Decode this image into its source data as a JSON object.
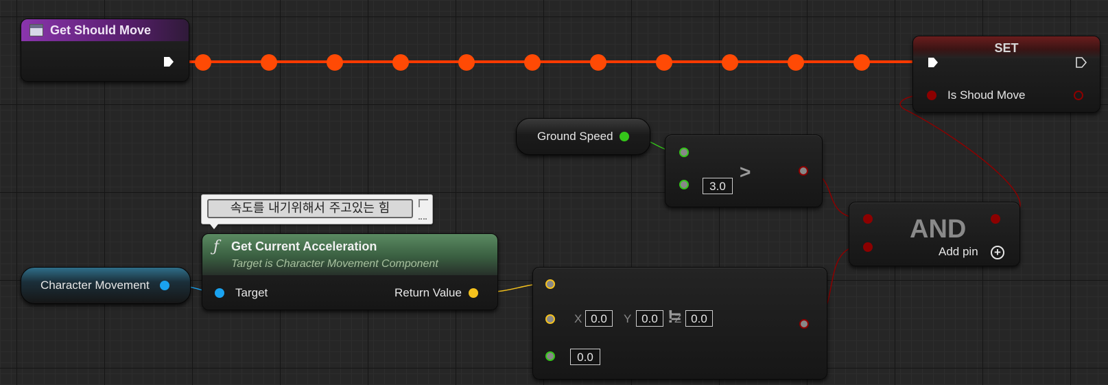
{
  "event_node": {
    "title": "Get Should Move",
    "header_color": "#6e2a8a"
  },
  "set_node": {
    "title": "SET",
    "pin_label": "Is Shoud Move",
    "header_color": "#5a1717"
  },
  "ground_speed_node": {
    "label": "Ground Speed",
    "pin_color": "#35c61a"
  },
  "greater_node": {
    "operator": ">",
    "b_value": "3.0"
  },
  "and_node": {
    "title": "AND",
    "add_pin_label": "Add pin"
  },
  "comment_bubble": {
    "text": "속도를 내기위해서 주고있는 힘"
  },
  "get_accel_node": {
    "title": "Get Current Acceleration",
    "subtitle": "Target is Character Movement Component",
    "target_label": "Target",
    "return_label": "Return Value",
    "header_color": "#3f6b45"
  },
  "char_movement_node": {
    "label": "Character Movement",
    "pin_color": "#1aa3f0"
  },
  "not_equal_node": {
    "x_label": "X",
    "x_value": "0.0",
    "y_label": "Y",
    "y_value": "0.0",
    "z_label": "Z",
    "z_value": "0.0",
    "tolerance_value": "0.0",
    "operator": "!="
  },
  "colors": {
    "exec_wire": "#ff3a00",
    "bool_pin": "#8c0000",
    "vector_pin": "#f5c21d",
    "float_pin": "#35c61a",
    "object_pin": "#1aa3f0"
  }
}
